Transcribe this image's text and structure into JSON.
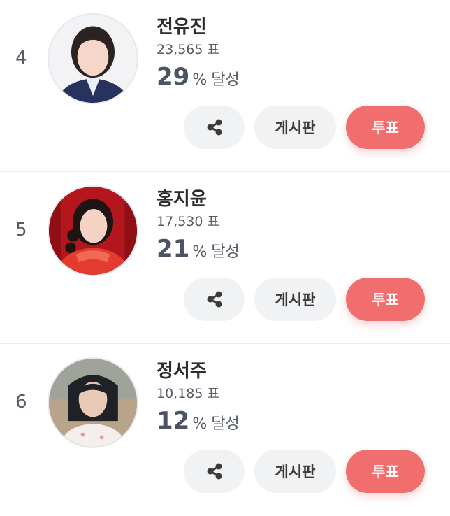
{
  "ranking": [
    {
      "rank": "4",
      "name": "전유진",
      "votes": "23,565 표",
      "percent": "29",
      "percent_sign": "%",
      "achieved_label": "달성",
      "share_icon": "share-icon",
      "board_label": "게시판",
      "vote_label": "투표",
      "avatar": "woman with dark hair in navy blazer, light background"
    },
    {
      "rank": "5",
      "name": "홍지윤",
      "votes": "17,530 표",
      "percent": "21",
      "percent_sign": "%",
      "achieved_label": "달성",
      "share_icon": "share-icon",
      "board_label": "게시판",
      "vote_label": "투표",
      "avatar": "woman in red dress with red curtain background"
    },
    {
      "rank": "6",
      "name": "정서주",
      "votes": "10,185 표",
      "percent": "12",
      "percent_sign": "%",
      "achieved_label": "달성",
      "share_icon": "share-icon",
      "board_label": "게시판",
      "vote_label": "투표",
      "avatar": "girl with bob haircut in white top, muted background"
    }
  ],
  "colors": {
    "vote_button": "#f06e6e",
    "neutral_button": "#f1f2f4",
    "divider": "#ececec",
    "percent_text": "#4a5462"
  }
}
